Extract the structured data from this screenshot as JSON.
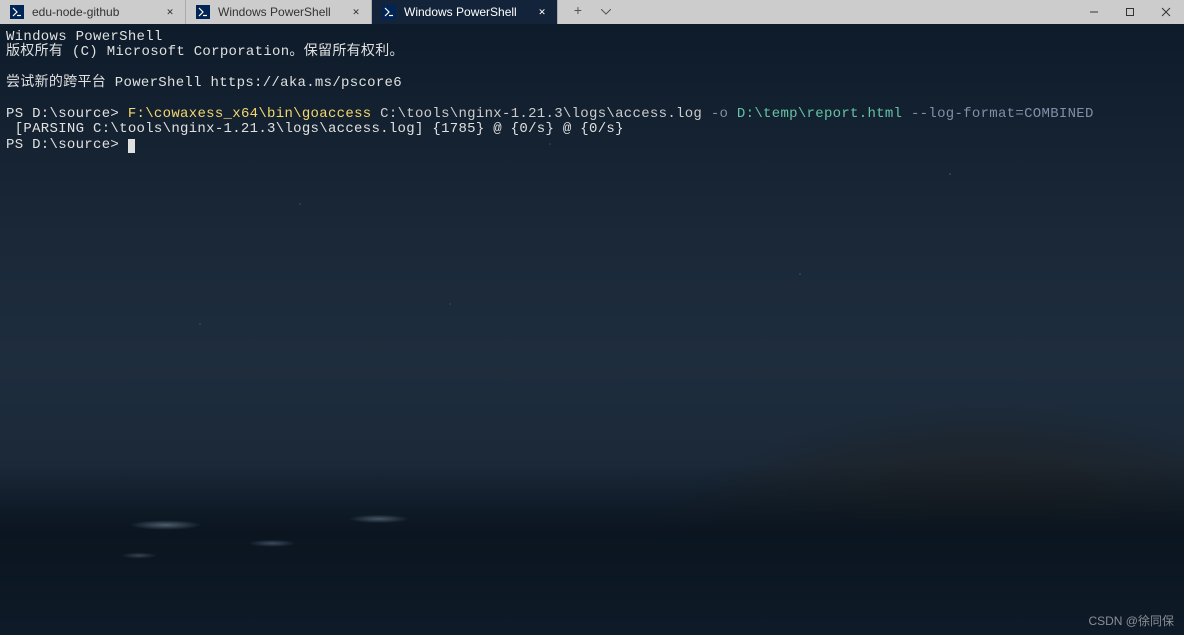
{
  "tabs": [
    {
      "label": "edu-node-github",
      "active": false
    },
    {
      "label": "Windows PowerShell",
      "active": false
    },
    {
      "label": "Windows PowerShell",
      "active": true
    }
  ],
  "terminal": {
    "header1": "Windows PowerShell",
    "header2": "版权所有 (C) Microsoft Corporation。保留所有权利。",
    "tryline": "尝试新的跨平台 PowerShell https://aka.ms/pscore6",
    "prompt1_prefix": "PS D:\\source> ",
    "cmd_bin": "F:\\cowaxess_x64\\bin\\goaccess",
    "cmd_arg_log": " C:\\tools\\nginx-1.21.3\\logs\\access.log ",
    "cmd_flag_o": "-o",
    "cmd_out": " D:\\temp\\report.html ",
    "cmd_logfmt": "--log-format=COMBINED",
    "parsing_line": " [PARSING C:\\tools\\nginx-1.21.3\\logs\\access.log] {1785} @ {0/s} @ {0/s}",
    "prompt2": "PS D:\\source> "
  },
  "watermark": "CSDN @徐同保"
}
